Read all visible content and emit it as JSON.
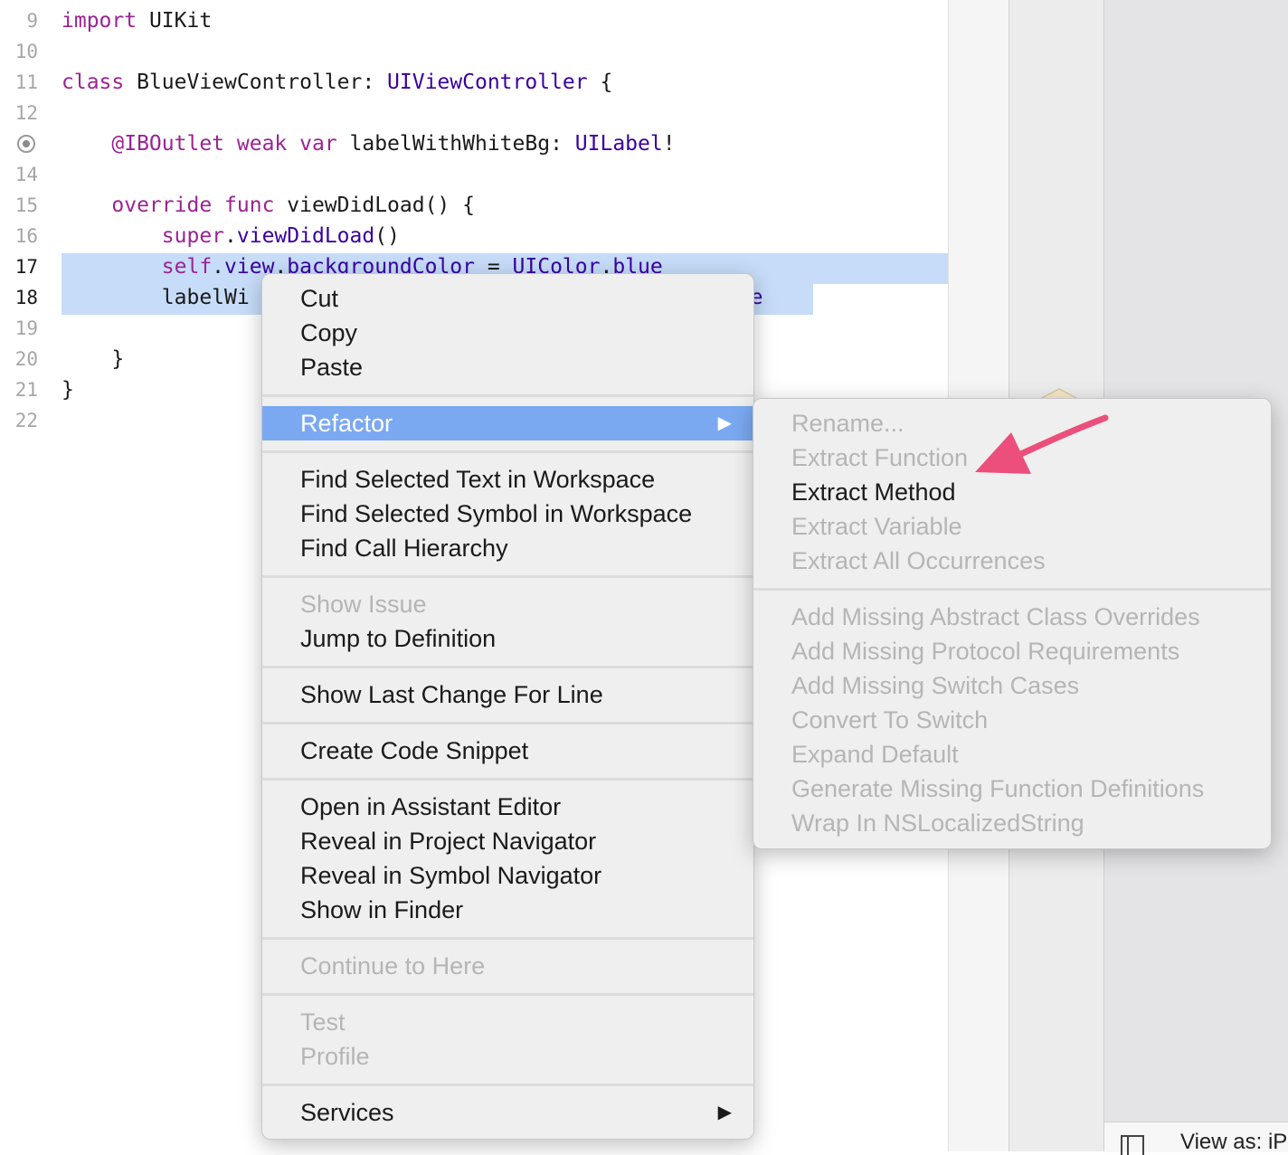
{
  "editor": {
    "lines": [
      {
        "num": "9",
        "tokens": [
          {
            "k": "kw",
            "t": "import"
          },
          {
            "k": "",
            "t": " UIKit"
          }
        ]
      },
      {
        "num": "10",
        "tokens": []
      },
      {
        "num": "11",
        "tokens": [
          {
            "k": "kw",
            "t": "class"
          },
          {
            "k": "",
            "t": " BlueViewController: "
          },
          {
            "k": "ty",
            "t": "UIViewController"
          },
          {
            "k": "",
            "t": " {"
          }
        ]
      },
      {
        "num": "12",
        "tokens": []
      },
      {
        "num": "",
        "tokens": [
          {
            "k": "",
            "t": "    "
          },
          {
            "k": "kw",
            "t": "@IBOutlet"
          },
          {
            "k": "",
            "t": " "
          },
          {
            "k": "kw",
            "t": "weak"
          },
          {
            "k": "",
            "t": " "
          },
          {
            "k": "kw",
            "t": "var"
          },
          {
            "k": "",
            "t": " labelWithWhiteBg: "
          },
          {
            "k": "ty",
            "t": "UILabel"
          },
          {
            "k": "",
            "t": "!"
          }
        ]
      },
      {
        "num": "14",
        "tokens": []
      },
      {
        "num": "15",
        "tokens": [
          {
            "k": "",
            "t": "    "
          },
          {
            "k": "kw",
            "t": "override"
          },
          {
            "k": "",
            "t": " "
          },
          {
            "k": "kw",
            "t": "func"
          },
          {
            "k": "",
            "t": " viewDidLoad() {"
          }
        ]
      },
      {
        "num": "16",
        "tokens": [
          {
            "k": "",
            "t": "        "
          },
          {
            "k": "kw",
            "t": "super"
          },
          {
            "k": "",
            "t": "."
          },
          {
            "k": "ty",
            "t": "viewDidLoad"
          },
          {
            "k": "",
            "t": "()"
          }
        ]
      },
      {
        "num": "17",
        "tokens": [
          {
            "k": "",
            "t": "        "
          },
          {
            "k": "kw",
            "t": "self"
          },
          {
            "k": "",
            "t": "."
          },
          {
            "k": "ty",
            "t": "view"
          },
          {
            "k": "",
            "t": "."
          },
          {
            "k": "ty",
            "t": "backgroundColor"
          },
          {
            "k": "",
            "t": " = "
          },
          {
            "k": "ty",
            "t": "UIColor"
          },
          {
            "k": "",
            "t": "."
          },
          {
            "k": "ty",
            "t": "blue"
          }
        ]
      },
      {
        "num": "18",
        "tokens": [
          {
            "k": "",
            "t": "        labelWi                                    "
          },
          {
            "k": "ty",
            "t": "white"
          }
        ]
      },
      {
        "num": "19",
        "tokens": []
      },
      {
        "num": "20",
        "tokens": [
          {
            "k": "",
            "t": "    }"
          }
        ]
      },
      {
        "num": "21",
        "tokens": [
          {
            "k": "",
            "t": "}"
          }
        ]
      },
      {
        "num": "22",
        "tokens": []
      }
    ]
  },
  "context_menu": {
    "items": [
      {
        "label": "Cut",
        "disabled": false
      },
      {
        "label": "Copy",
        "disabled": false
      },
      {
        "label": "Paste",
        "disabled": false
      },
      {
        "sep": true
      },
      {
        "label": "Refactor",
        "disabled": false,
        "highlighted": true,
        "submenu": true
      },
      {
        "sep": true
      },
      {
        "label": "Find Selected Text in Workspace",
        "disabled": false
      },
      {
        "label": "Find Selected Symbol in Workspace",
        "disabled": false
      },
      {
        "label": "Find Call Hierarchy",
        "disabled": false
      },
      {
        "sep": true
      },
      {
        "label": "Show Issue",
        "disabled": true
      },
      {
        "label": "Jump to Definition",
        "disabled": false
      },
      {
        "sep": true
      },
      {
        "label": "Show Last Change For Line",
        "disabled": false
      },
      {
        "sep": true
      },
      {
        "label": "Create Code Snippet",
        "disabled": false
      },
      {
        "sep": true
      },
      {
        "label": "Open in Assistant Editor",
        "disabled": false
      },
      {
        "label": "Reveal in Project Navigator",
        "disabled": false
      },
      {
        "label": "Reveal in Symbol Navigator",
        "disabled": false
      },
      {
        "label": "Show in Finder",
        "disabled": false
      },
      {
        "sep": true
      },
      {
        "label": "Continue to Here",
        "disabled": true
      },
      {
        "sep": true
      },
      {
        "label": "Test",
        "disabled": true
      },
      {
        "label": "Profile",
        "disabled": true
      },
      {
        "sep": true
      },
      {
        "label": "Services",
        "disabled": false,
        "submenu": true
      }
    ]
  },
  "refactor_submenu": {
    "items": [
      {
        "label": "Rename...",
        "disabled": true
      },
      {
        "label": "Extract Function",
        "disabled": true
      },
      {
        "label": "Extract Method",
        "disabled": false
      },
      {
        "label": "Extract Variable",
        "disabled": true
      },
      {
        "label": "Extract All Occurrences",
        "disabled": true
      },
      {
        "sep": true
      },
      {
        "label": "Add Missing Abstract Class Overrides",
        "disabled": true
      },
      {
        "label": "Add Missing Protocol Requirements",
        "disabled": true
      },
      {
        "label": "Add Missing Switch Cases",
        "disabled": true
      },
      {
        "label": "Convert To Switch",
        "disabled": true
      },
      {
        "label": "Expand Default",
        "disabled": true
      },
      {
        "label": "Generate Missing Function Definitions",
        "disabled": true
      },
      {
        "label": "Wrap In NSLocalizedString",
        "disabled": true
      }
    ]
  },
  "inspector": {
    "view_as_label": "View as: iP"
  },
  "colors": {
    "keyword": "#9b2393",
    "type": "#3900a0",
    "selection": "#c6dcf8",
    "menu_highlight": "#7aa9f2",
    "annotation_arrow": "#ec4f7b"
  }
}
